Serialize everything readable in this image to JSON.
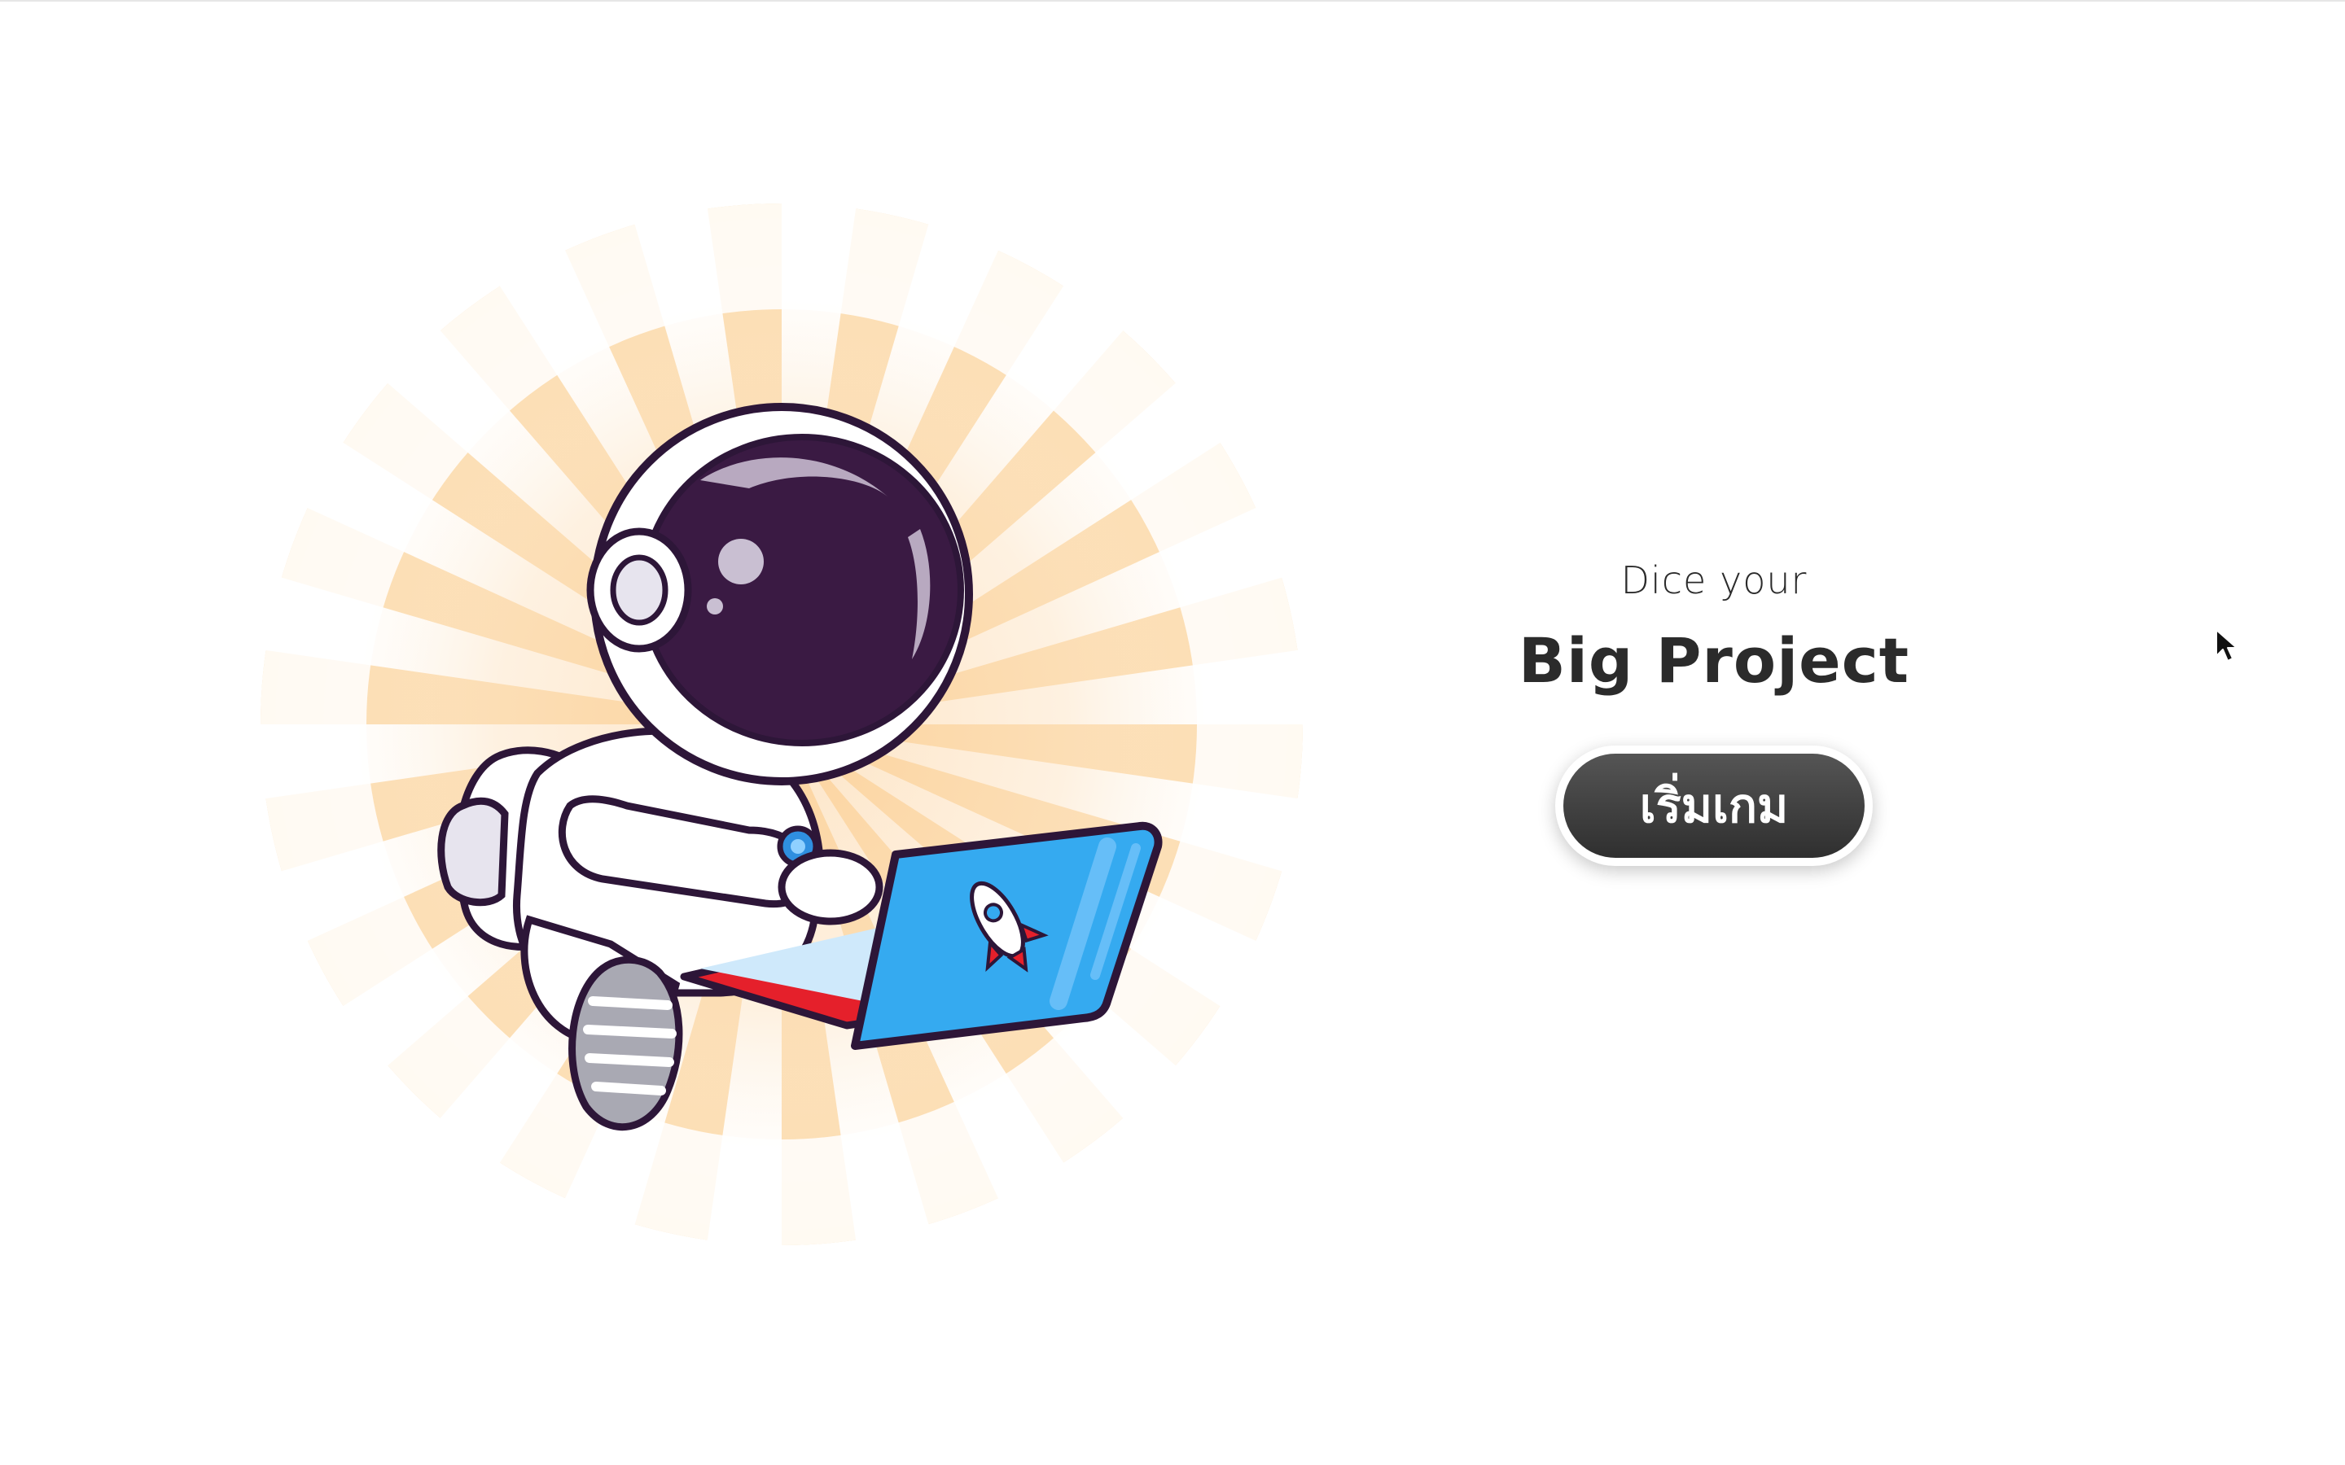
{
  "hero": {
    "illustration": "astronaut-with-laptop",
    "colors": {
      "sunburst": "#fcd9a8",
      "helmet": "#3a1a43",
      "suit": "#ffffff",
      "outline": "#2d1638",
      "laptop": "#35aaf0",
      "laptop_base": "#e5202b"
    }
  },
  "main": {
    "subtitle": "Dice your",
    "title": "Big Project",
    "start_label": "เริ่มเกม"
  },
  "colors": {
    "text": "#2b2b2b",
    "button_top": "#555555",
    "button_bottom": "#2f2f2f",
    "button_text": "#ffffff"
  }
}
